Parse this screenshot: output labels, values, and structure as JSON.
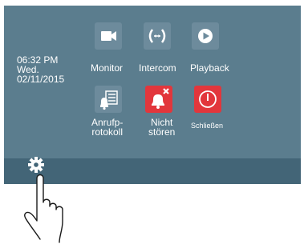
{
  "clock": {
    "time": "06:32 PM",
    "day": "Wed.",
    "date": "02/11/2015"
  },
  "tiles": [
    {
      "label": "Monitor",
      "icon": "video-camera-icon",
      "color": "#6d8b9c"
    },
    {
      "label": "Intercom",
      "icon": "intercom-icon",
      "color": "#6d8b9c"
    },
    {
      "label": "Playback",
      "icon": "play-icon",
      "color": "#6d8b9c"
    },
    {
      "label_line1": "Anrufp-",
      "label_line2": "rotokoll",
      "icon": "call-log-icon",
      "color": "#6d8b9c"
    },
    {
      "label_line1": "Nicht",
      "label_line2": "stören",
      "icon": "bell-mute-icon",
      "color": "#e2363c"
    },
    {
      "label": "Schließen",
      "icon": "power-icon",
      "color": "#e2363c"
    }
  ],
  "colors": {
    "screen": "#5b7d8e",
    "bottombar": "#436577",
    "tile": "#6d8b9c",
    "alert": "#e2363c"
  },
  "bottombar": {
    "settings_icon": "gear-icon"
  },
  "overlay": {
    "hand_icon": "pointing-hand-icon"
  }
}
